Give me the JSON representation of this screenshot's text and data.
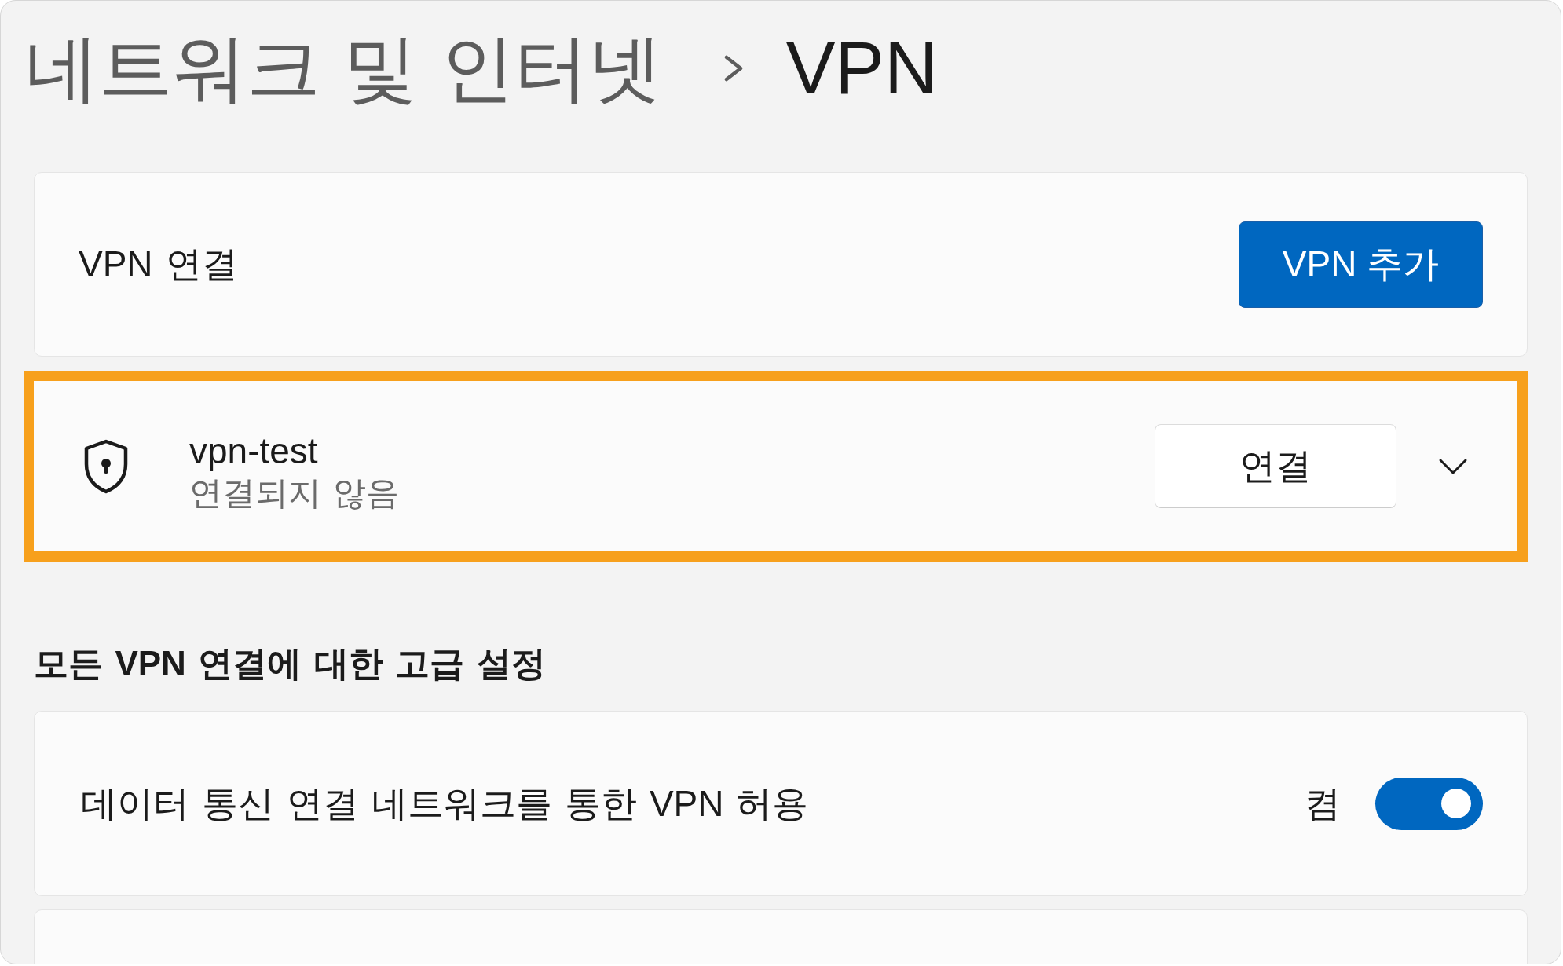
{
  "breadcrumb": [
    {
      "label": "네트워크 및 인터넷",
      "selected": false
    },
    {
      "label": "VPN",
      "selected": true
    }
  ],
  "vpn_connections": {
    "label": "VPN 연결",
    "add_button": "VPN 추가"
  },
  "connections": [
    {
      "name": "vpn-test",
      "status": "연결되지 않음",
      "connect_button": "연결",
      "highlighted": true,
      "expanded": false
    }
  ],
  "advanced": {
    "heading": "모든 VPN 연결에 대한 고급 설정",
    "settings": [
      {
        "kind": "toggle",
        "label": "데이터 통신 연결 네트워크를 통한 VPN 허용",
        "state_label": "켬",
        "on": true
      },
      {
        "kind": "card"
      }
    ]
  }
}
